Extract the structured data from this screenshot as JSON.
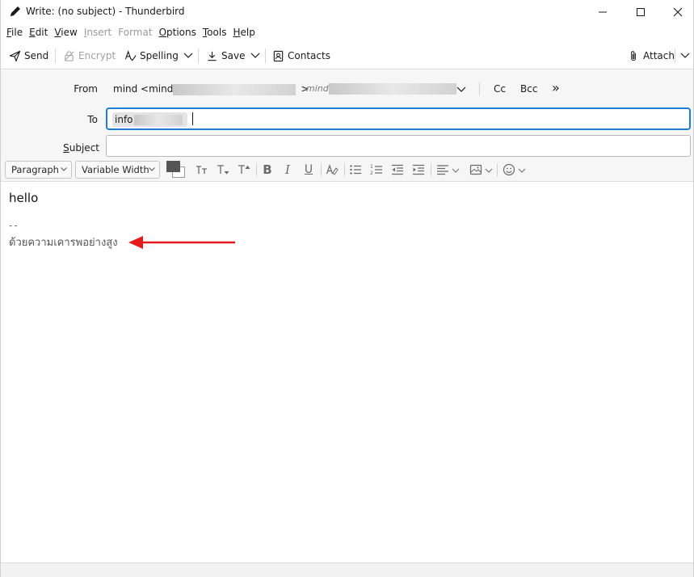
{
  "window": {
    "title": "Write: (no subject) - Thunderbird"
  },
  "menubar": [
    {
      "label": "File",
      "key": "F",
      "rest": "ile",
      "disabled": false
    },
    {
      "label": "Edit",
      "key": "E",
      "rest": "dit",
      "disabled": false
    },
    {
      "label": "View",
      "key": "V",
      "rest": "iew",
      "disabled": false
    },
    {
      "label": "Insert",
      "key": "I",
      "rest": "nsert",
      "disabled": true
    },
    {
      "label": "Format",
      "key": "",
      "rest": "Format",
      "disabled": true
    },
    {
      "label": "Options",
      "key": "O",
      "rest": "ptions",
      "disabled": false
    },
    {
      "label": "Tools",
      "key": "T",
      "rest": "ools",
      "disabled": false
    },
    {
      "label": "Help",
      "key": "H",
      "rest": "elp",
      "disabled": false
    }
  ],
  "toolbar": {
    "send": "Send",
    "encrypt": "Encrypt",
    "spelling": "Spelling",
    "save": "Save",
    "contacts": "Contacts",
    "attach": "Attach"
  },
  "header": {
    "from_label": "From",
    "from_name": "mind <mind",
    "from_close": ">",
    "from_identity": "mind",
    "cc": "Cc",
    "bcc": "Bcc",
    "more": "»",
    "to_label": "To",
    "to_pill": "info",
    "subject_label": "Subject",
    "subject_value": ""
  },
  "formatbar": {
    "paragraph": "Paragraph",
    "font": "Variable Width"
  },
  "body": {
    "greeting": "hello",
    "signature_separator": "--",
    "signature": "ด้วยความเคารพอย่างสูง"
  },
  "colors": {
    "focus_border": "#1f7dd8",
    "arrow": "#e31b1b",
    "header_bg": "#f6f6f6"
  }
}
